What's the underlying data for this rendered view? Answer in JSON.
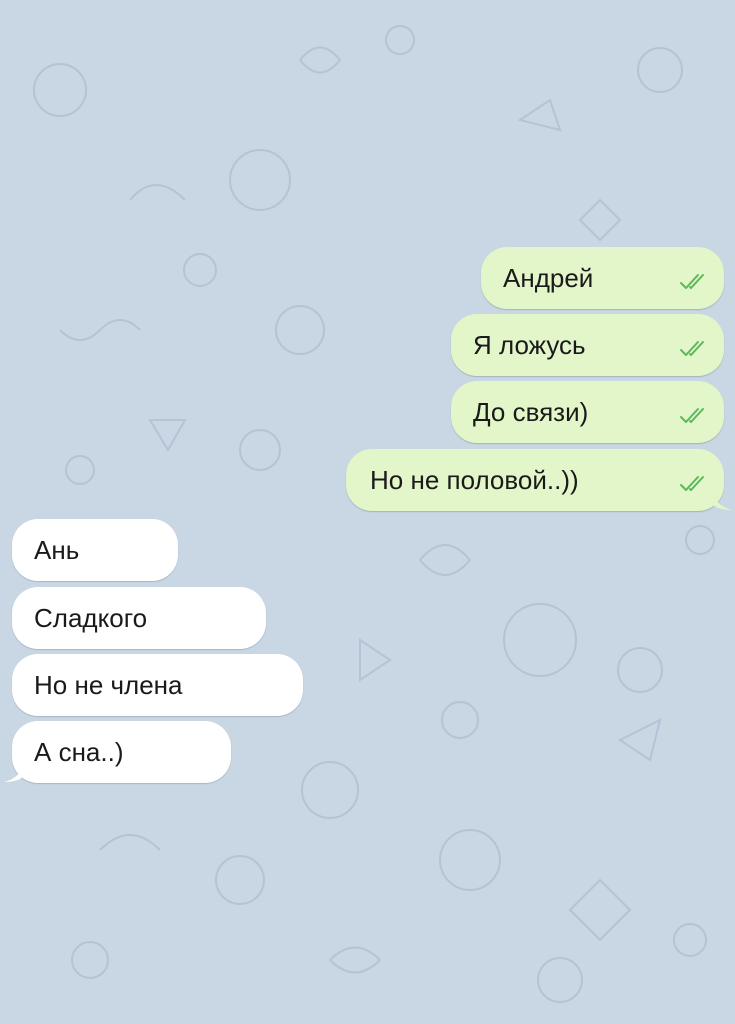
{
  "chat": {
    "outgoing": [
      {
        "text": "Андрей",
        "status": "read"
      },
      {
        "text": "Я ложусь",
        "status": "read"
      },
      {
        "text": "До связи)",
        "status": "read"
      },
      {
        "text": "Но не половой..))",
        "status": "read"
      }
    ],
    "incoming": [
      {
        "text": "Ань"
      },
      {
        "text": "Сладкого"
      },
      {
        "text": "Но не члена"
      },
      {
        "text": "А сна..)"
      }
    ]
  },
  "colors": {
    "background": "#c9d6e4",
    "outgoing_bubble": "#e3f6c9",
    "incoming_bubble": "#ffffff",
    "read_checks": "#5cb85c"
  },
  "icons": {
    "read_status": "double-check-icon"
  }
}
